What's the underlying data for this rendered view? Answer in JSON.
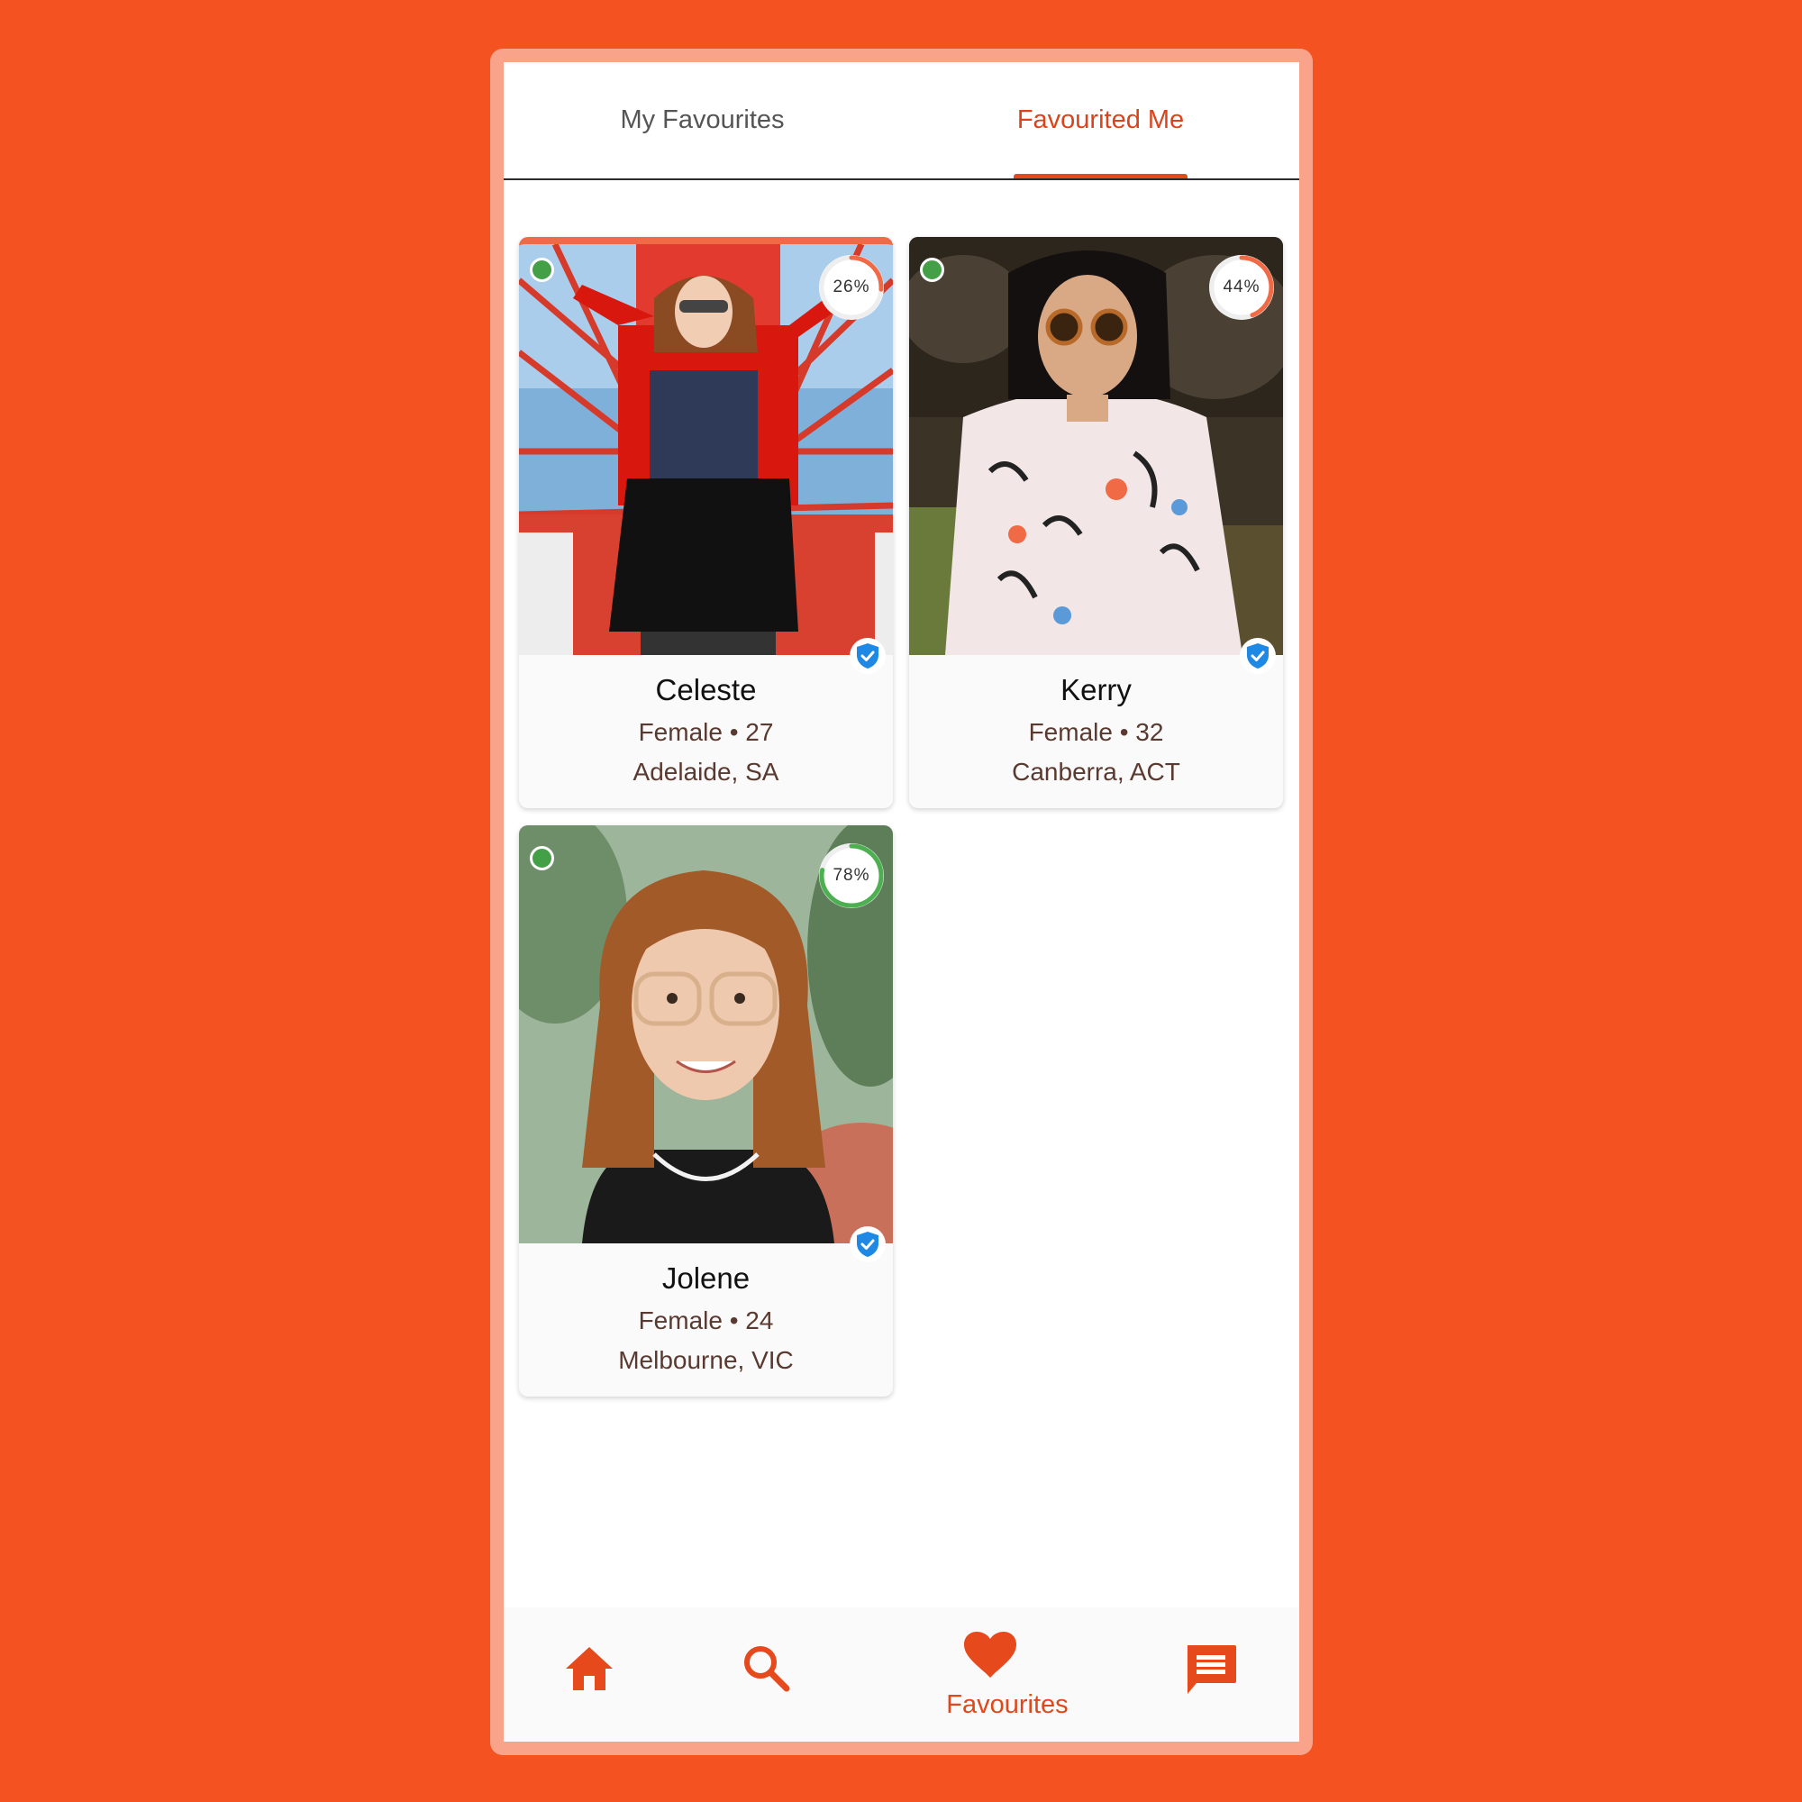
{
  "tabs": [
    {
      "label": "My Favourites",
      "active": false
    },
    {
      "label": "Favourited Me",
      "active": true
    }
  ],
  "cards": [
    {
      "name": "Celeste",
      "gender_age": "Female • 27",
      "location": "Adelaide, SA",
      "match": "26%",
      "match_value": 26,
      "match_color": "#F06A45",
      "online": true,
      "verified": true
    },
    {
      "name": "Kerry",
      "gender_age": "Female • 32",
      "location": "Canberra, ACT",
      "match": "44%",
      "match_value": 44,
      "match_color": "#F06A45",
      "online": true,
      "verified": true
    },
    {
      "name": "Jolene",
      "gender_age": "Female • 24",
      "location": "Melbourne, VIC",
      "match": "78%",
      "match_value": 78,
      "match_color": "#4CAF50",
      "online": true,
      "verified": true
    }
  ],
  "bottom_nav": {
    "items": [
      {
        "icon": "home-icon",
        "active": false
      },
      {
        "icon": "search-icon",
        "active": false
      },
      {
        "icon": "heart-icon",
        "active": true
      },
      {
        "icon": "chat-icon",
        "active": false
      }
    ],
    "active_label": "Favourites"
  },
  "colors": {
    "accent": "#E6491C",
    "background": "#F45220",
    "online": "#43A047",
    "verified": "#1E88E5"
  }
}
